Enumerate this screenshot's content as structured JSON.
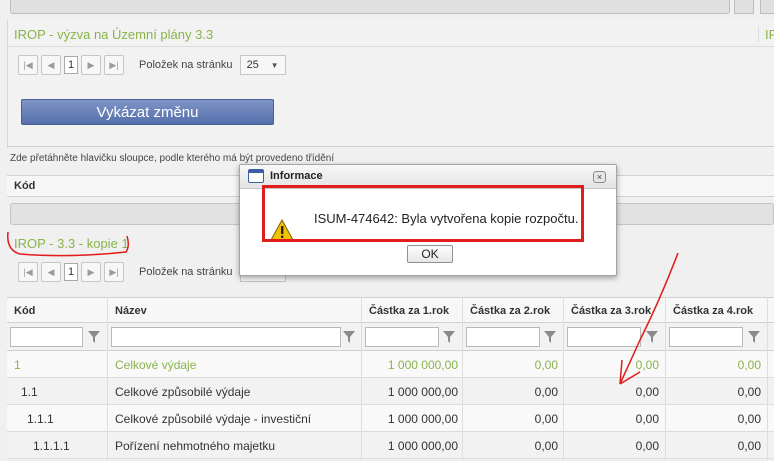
{
  "section1": {
    "title": "IROP - výzva na Územní plány 3.3",
    "title_right": "IF",
    "pager": {
      "page": "1",
      "per_page_label": "Položek na stránku",
      "per_page_value": "25"
    },
    "report_button": "Vykázat změnu"
  },
  "grouping": {
    "hint": "Zde přetáhněte hlavičku sloupce, podle kterého má být provedeno třídění",
    "column": "Kód"
  },
  "section2": {
    "title": "IROP - 3.3 - kopie 1",
    "pager": {
      "page": "1",
      "per_page_label": "Položek na stránku"
    }
  },
  "table": {
    "headers": [
      "Kód",
      "Název",
      "Částka za 1.rok",
      "Částka za 2.rok",
      "Částka za 3.rok",
      "Částka za 4.rok"
    ],
    "rows": [
      {
        "kod": "1",
        "nazev": "Celkové výdaje",
        "r1": "1 000 000,00",
        "r2": "0,00",
        "r3": "0,00",
        "r4": "0,00"
      },
      {
        "kod": "1.1",
        "nazev": "Celkové způsobilé výdaje",
        "r1": "1 000 000,00",
        "r2": "0,00",
        "r3": "0,00",
        "r4": "0,00"
      },
      {
        "kod": "1.1.1",
        "nazev": "Celkové způsobilé výdaje - investiční",
        "r1": "1 000 000,00",
        "r2": "0,00",
        "r3": "0,00",
        "r4": "0,00"
      },
      {
        "kod": "1.1.1.1",
        "nazev": "Pořízení nehmotného majetku",
        "r1": "1 000 000,00",
        "r2": "0,00",
        "r3": "0,00",
        "r4": "0,00"
      }
    ]
  },
  "dialog": {
    "title": "Informace",
    "message": "ISUM-474642: Byla vytvořena kopie rozpočtu.",
    "ok": "OK",
    "close": "×"
  },
  "colors": {
    "accent_green": "#8ab34a",
    "button_blue": "#5d74b1",
    "annotation_red": "#e01c1c"
  }
}
